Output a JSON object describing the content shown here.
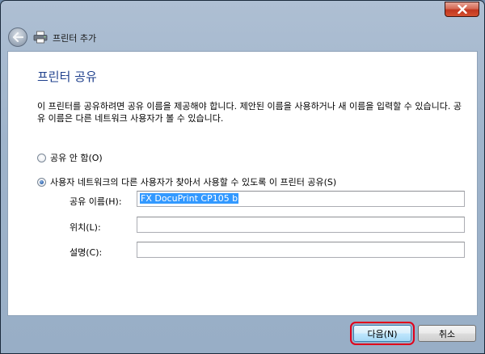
{
  "window": {
    "title": "프린터 추가"
  },
  "page": {
    "heading": "프린터 공유",
    "description": "이 프린터를 공유하려면 공유 이름을 제공해야 합니다. 제안된 이름을 사용하거나 새 이름을 입력할 수 있습니다. 공유 이름은 다른 네트워크 사용자가 볼 수 있습니다."
  },
  "options": {
    "no_share": {
      "label": "공유 안 함(O)",
      "checked": false
    },
    "share": {
      "label": "사용자 네트워크의 다른 사용자가 찾아서 사용할 수 있도록 이 프린터 공유(S)",
      "checked": true
    }
  },
  "fields": {
    "share_name": {
      "label": "공유 이름(H):",
      "value": "FX DocuPrint CP105 b"
    },
    "location": {
      "label": "위치(L):",
      "value": ""
    },
    "comment": {
      "label": "설명(C):",
      "value": ""
    }
  },
  "buttons": {
    "next": "다음(N)",
    "cancel": "취소"
  }
}
